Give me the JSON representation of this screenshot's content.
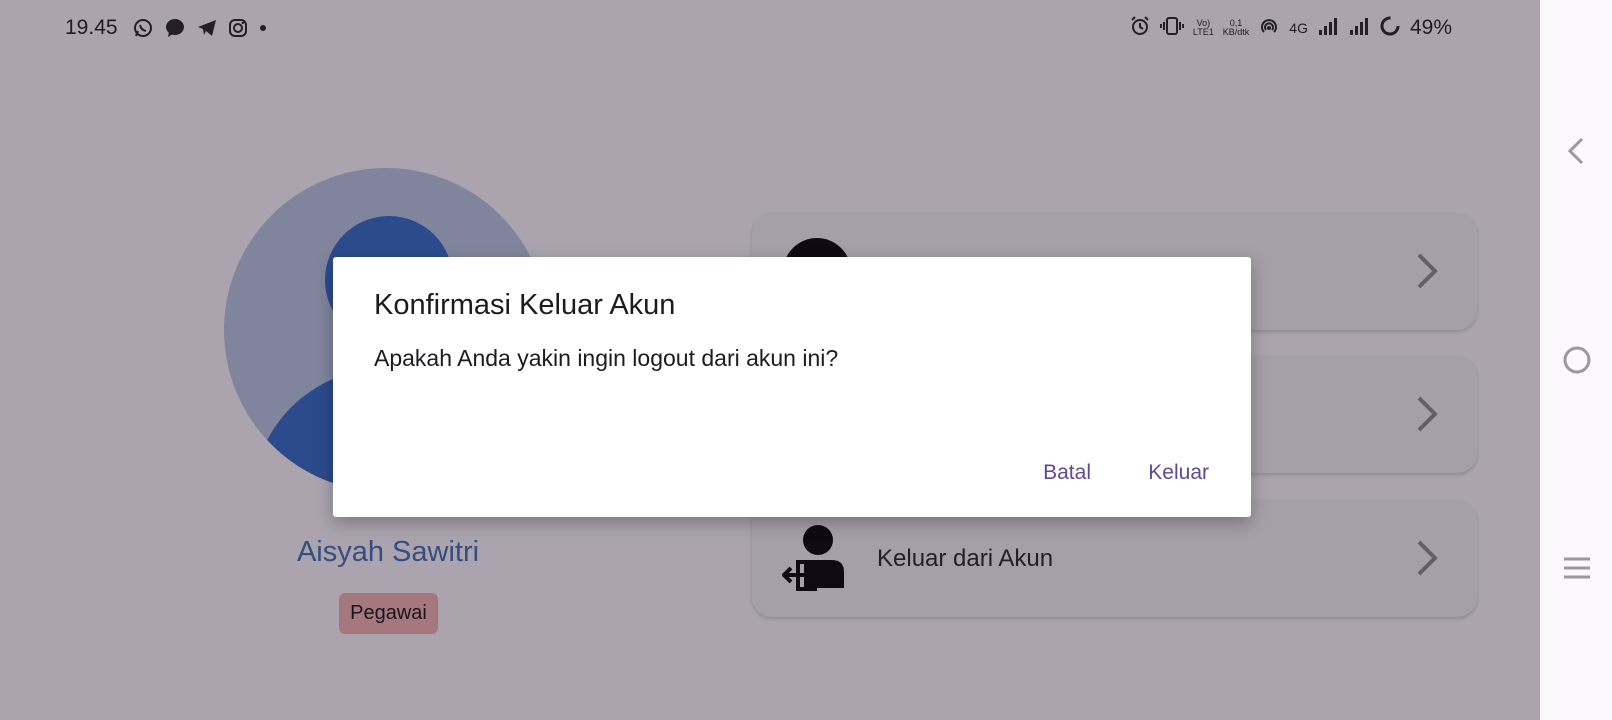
{
  "status_bar": {
    "time": "19.45",
    "notification_icons": [
      "whatsapp-icon",
      "chat-bubble-icon",
      "telegram-icon",
      "instagram-icon",
      "more-dot-icon"
    ],
    "system_icons": [
      "alarm-icon",
      "vibrate-icon",
      "volte-icon",
      "network-speed",
      "hotspot-icon",
      "signal-icon",
      "signal-icon",
      "battery-saver-icon"
    ],
    "volte_label": "Vo)\nLTE1",
    "net_speed_value": "0,1",
    "net_speed_unit": "KB/dtk",
    "network_type": "4G",
    "battery": "49%"
  },
  "profile": {
    "name": "Aisyah Sawitri",
    "role": "Pegawai",
    "avatar_colors": {
      "background": "#b7c7e3",
      "figure": "#2f6ac9"
    }
  },
  "menu": {
    "items": [
      {
        "label": "",
        "icon": "account-icon"
      },
      {
        "label": "",
        "icon": "settings-icon"
      },
      {
        "label": "Keluar dari Akun",
        "icon": "logout-user-icon"
      }
    ]
  },
  "dialog": {
    "title": "Konfirmasi Keluar Akun",
    "message": "Apakah Anda yakin ingin logout dari akun ini?",
    "cancel_label": "Batal",
    "confirm_label": "Keluar",
    "accent_color": "#5e4b92"
  },
  "navigation_bar": {
    "buttons": [
      "back-icon",
      "home-icon",
      "recents-icon"
    ]
  }
}
